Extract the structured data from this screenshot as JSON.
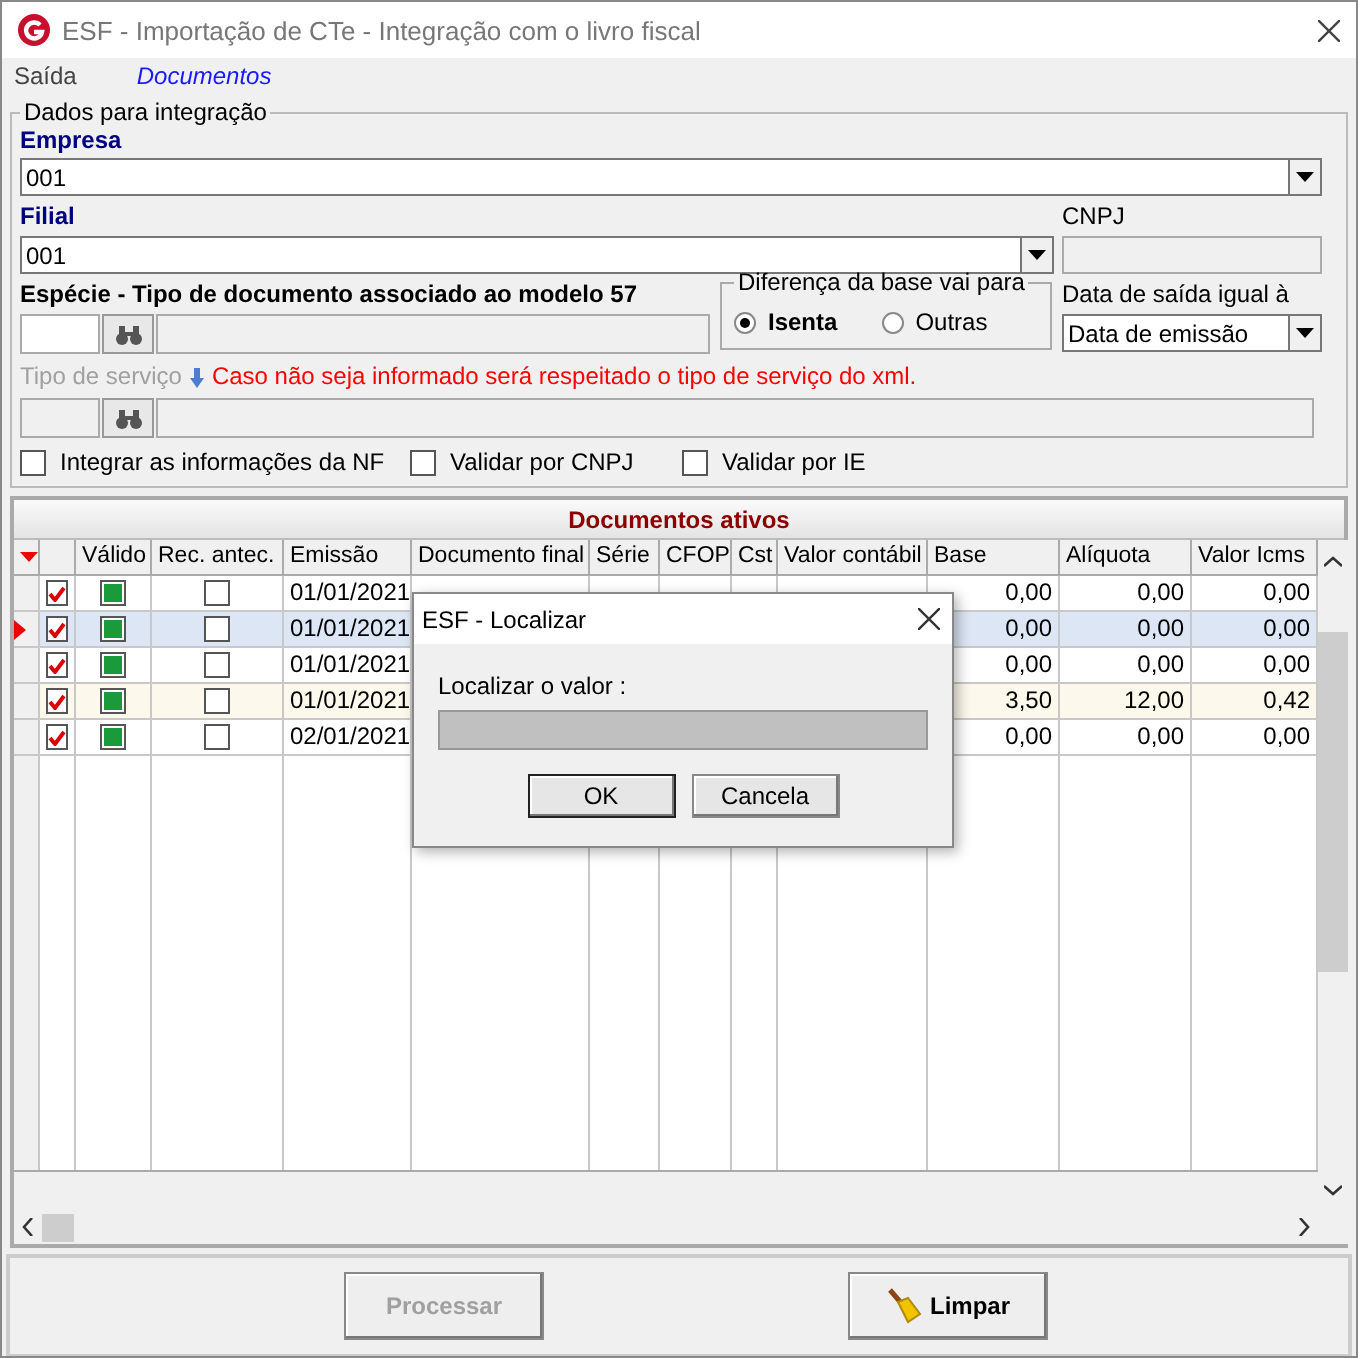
{
  "window": {
    "title": "ESF - Importação de CTe - Integração com o livro fiscal"
  },
  "menu": [
    {
      "label": "Saída",
      "kind": "menu"
    },
    {
      "label": "Documentos",
      "kind": "link"
    }
  ],
  "integration": {
    "title": "Dados para integração",
    "empresa": {
      "label": "Empresa",
      "value": "001"
    },
    "filial": {
      "label": "Filial",
      "value": "001"
    },
    "cnpj": {
      "label": "CNPJ"
    },
    "especie": {
      "label": "Espécie - Tipo de documento associado ao modelo 57"
    },
    "diferenca": {
      "title": "Diferença da base vai para",
      "options": [
        {
          "label": "Isenta",
          "selected": true
        },
        {
          "label": "Outras",
          "selected": false
        }
      ]
    },
    "data_saida": {
      "label": "Data de saída igual à",
      "value": "Data de emissão"
    },
    "tipo_servico": {
      "label": "Tipo de serviço",
      "note": "Caso não seja informado será respeitado o tipo de serviço do xml."
    },
    "checkboxes": [
      {
        "label": "Integrar as informações da NF",
        "checked": false
      },
      {
        "label": "Validar por CNPJ",
        "checked": false
      },
      {
        "label": "Validar por IE",
        "checked": false
      }
    ]
  },
  "grid": {
    "title": "Documentos ativos",
    "columns": [
      "Válido",
      "Rec. antec.",
      "Emissão",
      "Documento final",
      "Série",
      "CFOP",
      "Cst",
      "Valor contábil",
      "Base",
      "Alíquota",
      "Valor Icms"
    ],
    "rows": [
      {
        "selected": false,
        "highlighted": false,
        "checked": true,
        "valid": true,
        "rec_antec": false,
        "emissao": "01/01/2021",
        "base": "0,00",
        "aliquota": "0,00",
        "valor_icms": "0,00"
      },
      {
        "selected": true,
        "highlighted": false,
        "checked": true,
        "valid": true,
        "rec_antec": false,
        "emissao": "01/01/2021",
        "base": "0,00",
        "aliquota": "0,00",
        "valor_icms": "0,00"
      },
      {
        "selected": false,
        "highlighted": false,
        "checked": true,
        "valid": true,
        "rec_antec": false,
        "emissao": "01/01/2021",
        "base": "0,00",
        "aliquota": "0,00",
        "valor_icms": "0,00"
      },
      {
        "selected": false,
        "highlighted": true,
        "checked": true,
        "valid": true,
        "rec_antec": false,
        "emissao": "01/01/2021",
        "base": "3,50",
        "aliquota": "12,00",
        "valor_icms": "0,42"
      },
      {
        "selected": false,
        "highlighted": false,
        "checked": true,
        "valid": true,
        "rec_antec": false,
        "emissao": "02/01/2021",
        "base": "0,00",
        "aliquota": "0,00",
        "valor_icms": "0,00"
      }
    ]
  },
  "dialog": {
    "title": "ESF - Localizar",
    "label": "Localizar o valor :",
    "buttons": [
      {
        "label": "OK",
        "default": true
      },
      {
        "label": "Cancela",
        "default": false
      }
    ]
  },
  "buttons": [
    {
      "label": "Processar",
      "disabled": true,
      "kind": "plain"
    },
    {
      "label": "Limpar",
      "disabled": false,
      "kind": "broom"
    }
  ]
}
